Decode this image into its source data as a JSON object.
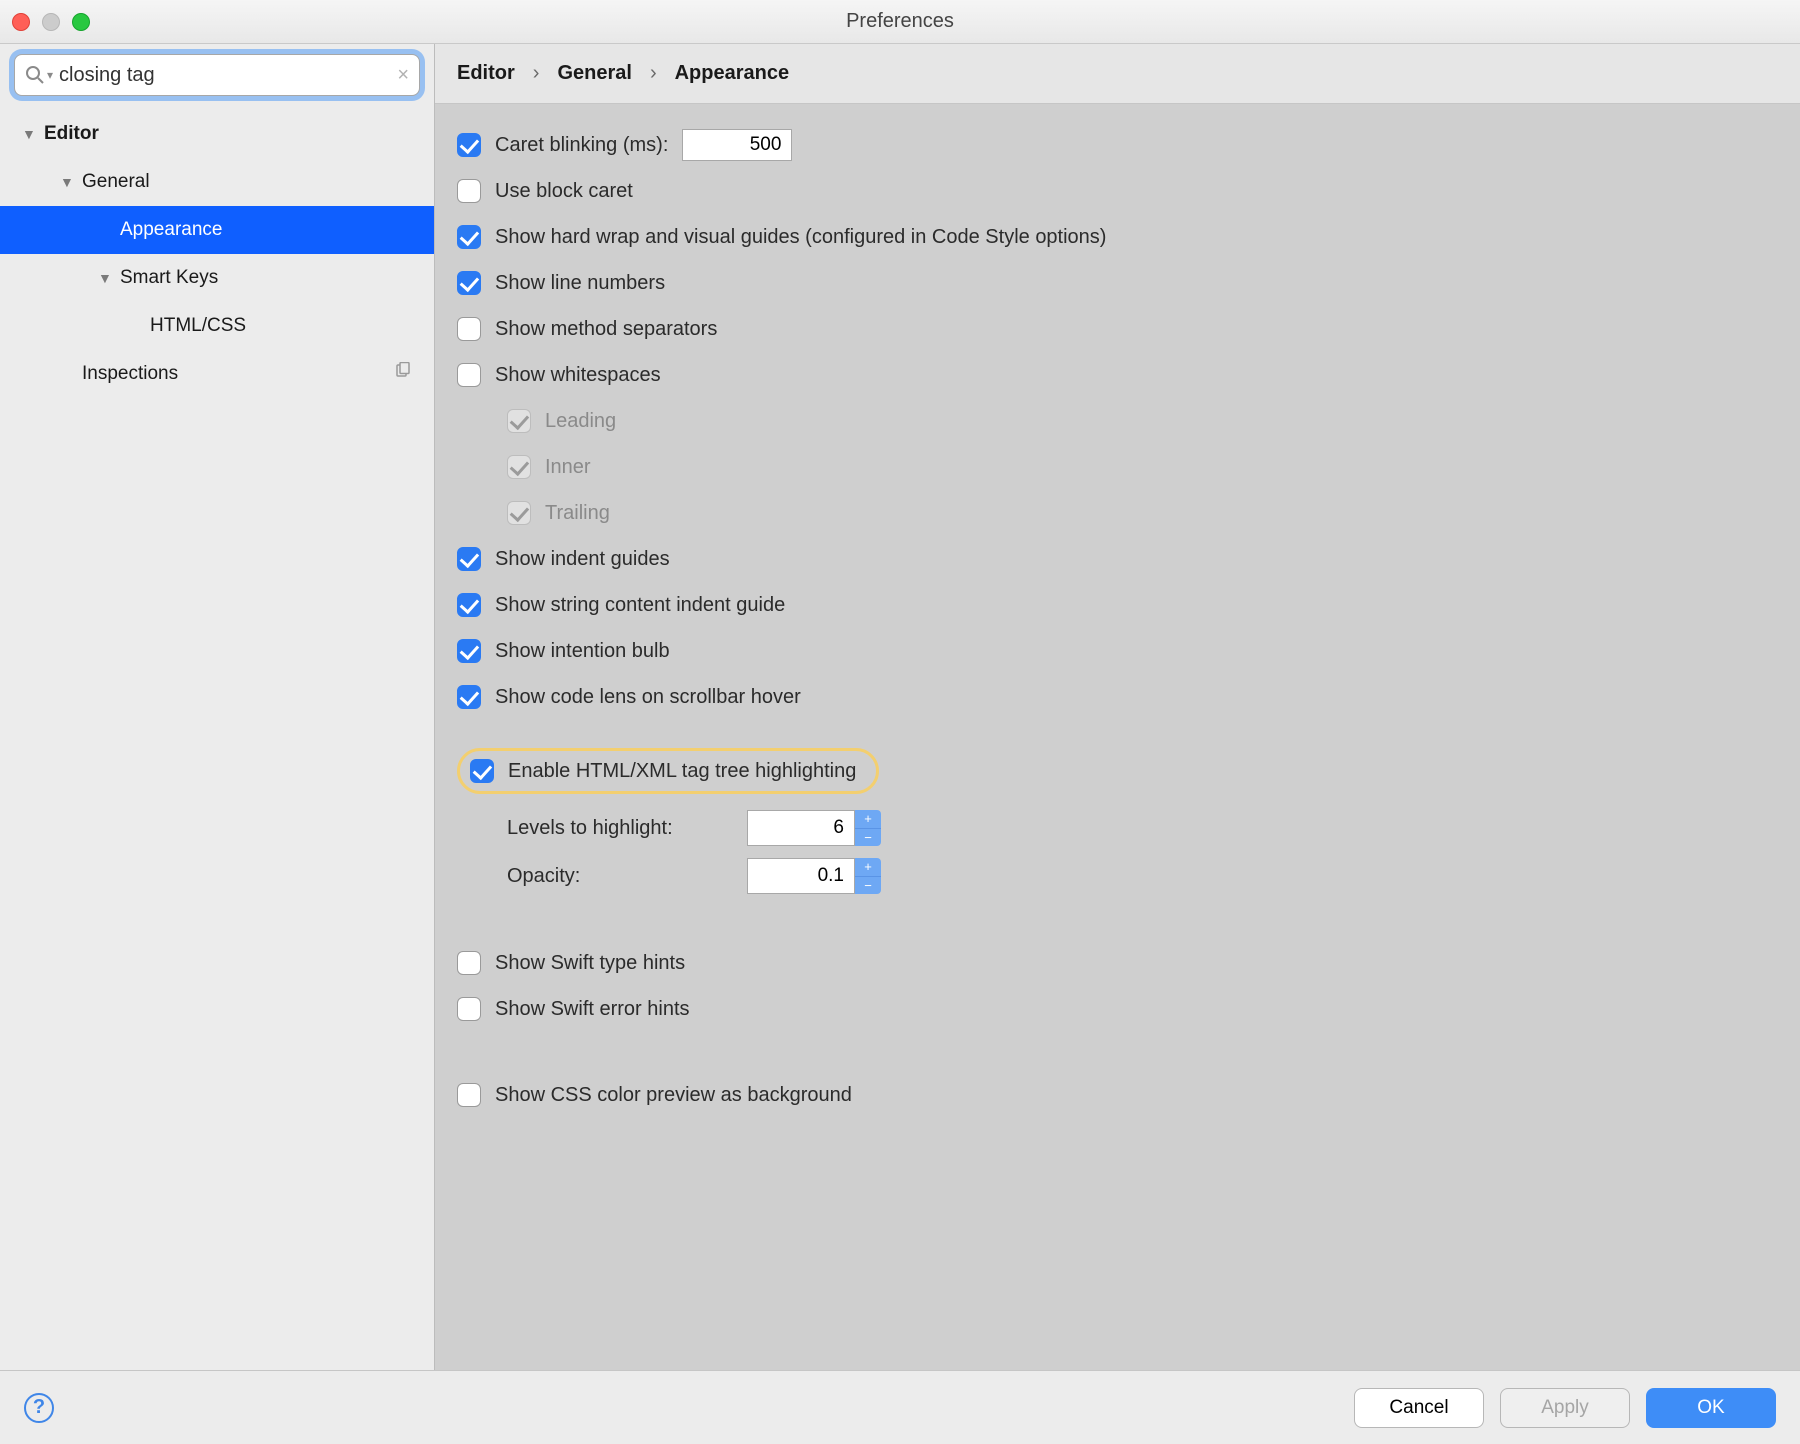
{
  "window": {
    "title": "Preferences"
  },
  "search": {
    "value": "closing tag"
  },
  "sidebar": {
    "items": [
      {
        "label": "Editor"
      },
      {
        "label": "General"
      },
      {
        "label": "Appearance"
      },
      {
        "label": "Smart Keys"
      },
      {
        "label": "HTML/CSS"
      },
      {
        "label": "Inspections"
      }
    ]
  },
  "crumbs": {
    "a": "Editor",
    "b": "General",
    "c": "Appearance"
  },
  "settings": {
    "caret_blinking_label": "Caret blinking (ms):",
    "caret_blinking_value": "500",
    "use_block_caret": "Use block caret",
    "show_hard_wrap": "Show hard wrap and visual guides (configured in Code Style options)",
    "show_line_numbers": "Show line numbers",
    "show_method_separators": "Show method separators",
    "show_whitespaces": "Show whitespaces",
    "ws_leading": "Leading",
    "ws_inner": "Inner",
    "ws_trailing": "Trailing",
    "show_indent_guides": "Show indent guides",
    "show_string_indent": "Show string content indent guide",
    "show_intention_bulb": "Show intention bulb",
    "show_code_lens": "Show code lens on scrollbar hover",
    "enable_tag_tree": "Enable HTML/XML tag tree highlighting",
    "levels_label": "Levels to highlight:",
    "levels_value": "6",
    "opacity_label": "Opacity:",
    "opacity_value": "0.1",
    "show_swift_type": "Show Swift type hints",
    "show_swift_error": "Show Swift error hints",
    "show_css_color": "Show CSS color preview as background"
  },
  "footer": {
    "cancel": "Cancel",
    "apply": "Apply",
    "ok": "OK"
  }
}
